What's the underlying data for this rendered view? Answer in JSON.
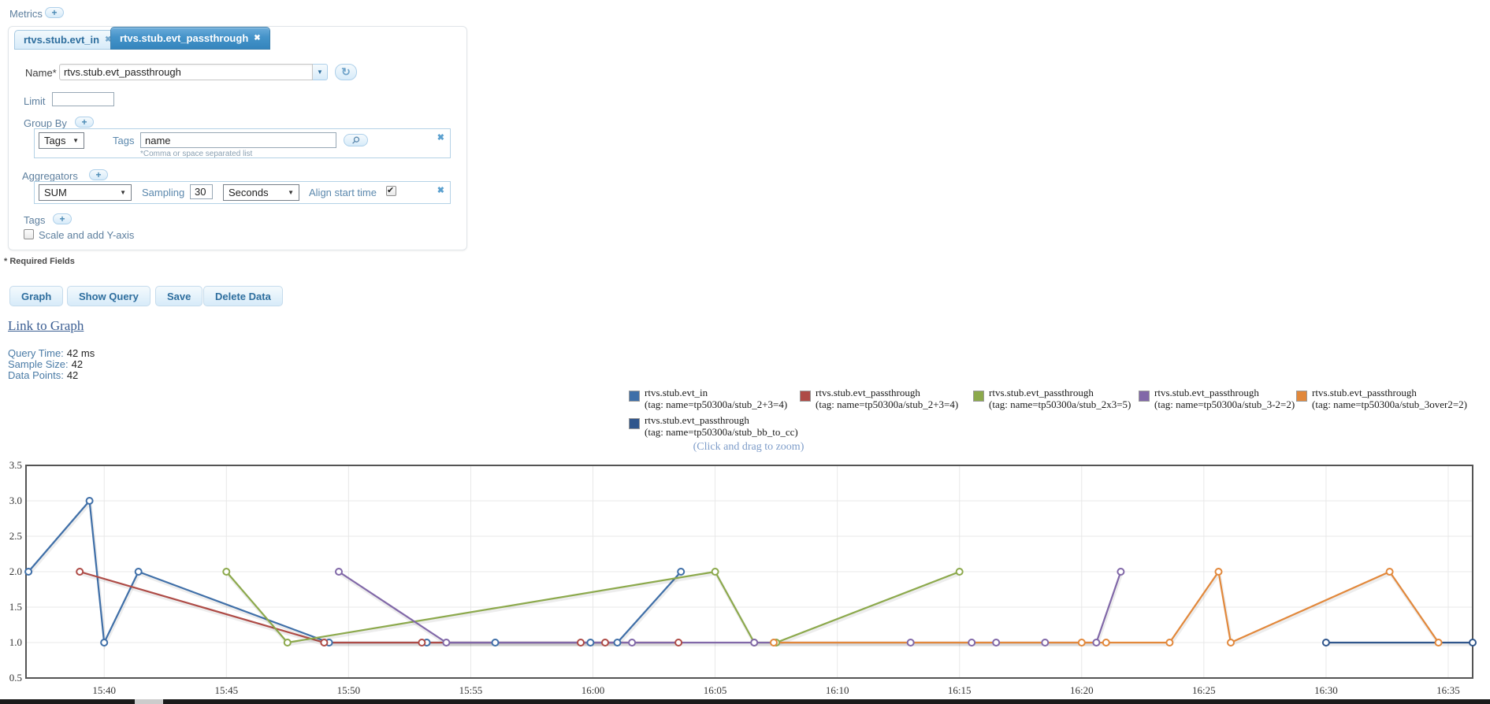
{
  "header": {
    "metrics_label": "Metrics",
    "add_button": "+"
  },
  "icons": {
    "close": "✖",
    "dropdown": "▼",
    "refresh": "↻"
  },
  "tabs": [
    {
      "label": "rtvs.stub.evt_in"
    },
    {
      "label": "rtvs.stub.evt_passthrough"
    }
  ],
  "form": {
    "name_label": "Name*",
    "name_value": "rtvs.stub.evt_passthrough",
    "limit_label": "Limit",
    "limit_value": "",
    "group_by": {
      "section_label": "Group By",
      "add_button": "+",
      "type_value": "Tags",
      "tags_label": "Tags",
      "tags_value": "name",
      "hint": "*Comma or space separated list"
    },
    "aggregators": {
      "section_label": "Aggregators",
      "add_button": "+",
      "aggregator_value": "SUM",
      "sampling_label": "Sampling",
      "sampling_value": "30",
      "sampling_unit": "Seconds",
      "align_label": "Align start time",
      "align_checked": true
    },
    "tags": {
      "section_label": "Tags",
      "add_button": "+",
      "scale_label": "Scale and add Y-axis",
      "scale_checked": false
    },
    "required_note": "* Required Fields"
  },
  "buttons": {
    "graph": "Graph",
    "show_query": "Show Query",
    "save": "Save",
    "delete_data": "Delete Data"
  },
  "link_to_graph": "Link to Graph",
  "stats": {
    "query_time_label": "Query Time:",
    "query_time_value": "42 ms",
    "sample_size_label": "Sample Size:",
    "sample_size_value": "42",
    "data_points_label": "Data Points:",
    "data_points_value": "42"
  },
  "chart_hint": "(Click and drag to zoom)",
  "chart_data": {
    "type": "line",
    "title": "",
    "xlabel": "",
    "ylabel": "",
    "x_encoding": "minutes after 15:00",
    "xlim": [
      36.8,
      96.0
    ],
    "ylim": [
      0.5,
      3.5
    ],
    "grid": true,
    "legend_position": "top",
    "x_ticks": [
      {
        "v": 40,
        "label": "15:40"
      },
      {
        "v": 45,
        "label": "15:45"
      },
      {
        "v": 50,
        "label": "15:50"
      },
      {
        "v": 55,
        "label": "15:55"
      },
      {
        "v": 60,
        "label": "16:00"
      },
      {
        "v": 65,
        "label": "16:05"
      },
      {
        "v": 70,
        "label": "16:10"
      },
      {
        "v": 75,
        "label": "16:15"
      },
      {
        "v": 80,
        "label": "16:20"
      },
      {
        "v": 85,
        "label": "16:25"
      },
      {
        "v": 90,
        "label": "16:30"
      },
      {
        "v": 95,
        "label": "16:35"
      }
    ],
    "y_ticks": [
      "0.5",
      "1.0",
      "1.5",
      "2.0",
      "2.5",
      "3.0",
      "3.5"
    ],
    "series": [
      {
        "name": "rtvs.stub.evt_in",
        "tag": "(tag: name=tp50300a/stub_2+3=4)",
        "color": "#3f6fa8",
        "points": [
          [
            36.9,
            2
          ],
          [
            39.4,
            3
          ],
          [
            40,
            1
          ],
          [
            41.4,
            2
          ],
          [
            49.2,
            1
          ],
          [
            53.2,
            1
          ],
          [
            56,
            1
          ],
          [
            59.9,
            1
          ],
          [
            61,
            1
          ],
          [
            63.6,
            2
          ]
        ]
      },
      {
        "name": "rtvs.stub.evt_passthrough",
        "tag": "(tag: name=tp50300a/stub_2+3=4)",
        "color": "#ae4b46",
        "points": [
          [
            39,
            2
          ],
          [
            49,
            1
          ],
          [
            53,
            1
          ],
          [
            59.5,
            1
          ],
          [
            60.5,
            1
          ],
          [
            63.5,
            1
          ]
        ]
      },
      {
        "name": "rtvs.stub.evt_passthrough",
        "tag": "(tag: name=tp50300a/stub_2x3=5)",
        "color": "#8ca94c",
        "points": [
          [
            45,
            2
          ],
          [
            47.5,
            1
          ],
          [
            65,
            2
          ],
          [
            66.6,
            1
          ],
          [
            67.5,
            1
          ],
          [
            75,
            2
          ]
        ]
      },
      {
        "name": "rtvs.stub.evt_passthrough",
        "tag": "(tag: name=tp50300a/stub_3-2=2)",
        "color": "#8168a8",
        "points": [
          [
            49.6,
            2
          ],
          [
            54,
            1
          ],
          [
            61.6,
            1
          ],
          [
            66.6,
            1
          ],
          [
            73,
            1
          ],
          [
            75.5,
            1
          ],
          [
            76.5,
            1
          ],
          [
            78.5,
            1
          ],
          [
            80.6,
            1
          ],
          [
            81.6,
            2
          ]
        ]
      },
      {
        "name": "rtvs.stub.evt_passthrough",
        "tag": "(tag: name=tp50300a/stub_3over2=2)",
        "color": "#e2883b",
        "points": [
          [
            67.4,
            1
          ],
          [
            80,
            1
          ],
          [
            81,
            1
          ],
          [
            83.6,
            1
          ],
          [
            85.6,
            2
          ],
          [
            86.1,
            1
          ],
          [
            92.6,
            2
          ],
          [
            94.6,
            1
          ]
        ]
      },
      {
        "name": "rtvs.stub.evt_passthrough",
        "tag": "(tag: name=tp50300a/stub_bb_to_cc)",
        "color": "#30568c",
        "points": [
          [
            90,
            1
          ],
          [
            96,
            1
          ]
        ]
      }
    ]
  }
}
